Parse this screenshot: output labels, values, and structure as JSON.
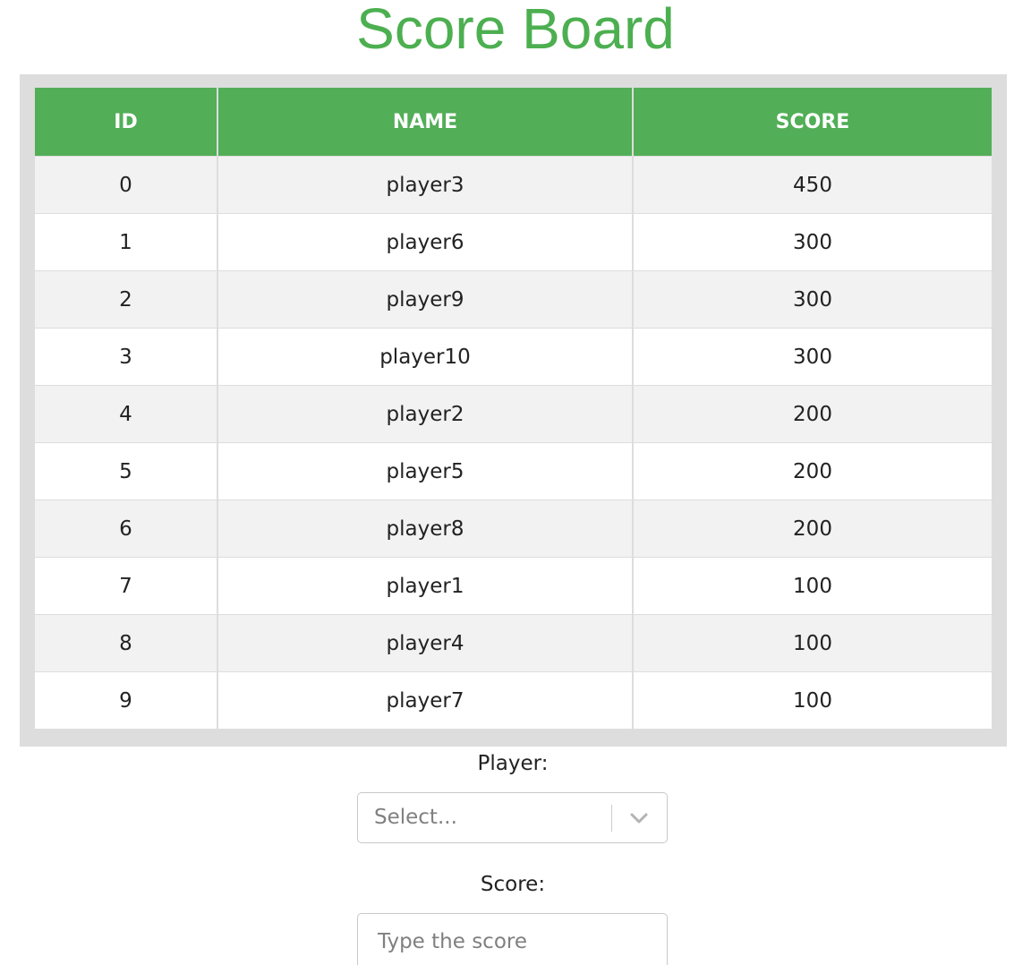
{
  "page": {
    "title": "Score Board"
  },
  "table": {
    "headers": {
      "id": "ID",
      "name": "NAME",
      "score": "SCORE"
    },
    "rows": [
      {
        "id": "0",
        "name": "player3",
        "score": "450"
      },
      {
        "id": "1",
        "name": "player6",
        "score": "300"
      },
      {
        "id": "2",
        "name": "player9",
        "score": "300"
      },
      {
        "id": "3",
        "name": "player10",
        "score": "300"
      },
      {
        "id": "4",
        "name": "player2",
        "score": "200"
      },
      {
        "id": "5",
        "name": "player5",
        "score": "200"
      },
      {
        "id": "6",
        "name": "player8",
        "score": "200"
      },
      {
        "id": "7",
        "name": "player1",
        "score": "100"
      },
      {
        "id": "8",
        "name": "player4",
        "score": "100"
      },
      {
        "id": "9",
        "name": "player7",
        "score": "100"
      }
    ]
  },
  "form": {
    "player_label": "Player:",
    "player_select_placeholder": "Select...",
    "score_label": "Score:",
    "score_placeholder": "Type the score"
  },
  "colors": {
    "accent": "#4caf50",
    "header_bg": "#52ae57",
    "frame_bg": "#dddddd",
    "stripe_bg": "#f2f2f2"
  },
  "icons": {
    "select_indicator": "chevron-down-icon"
  }
}
